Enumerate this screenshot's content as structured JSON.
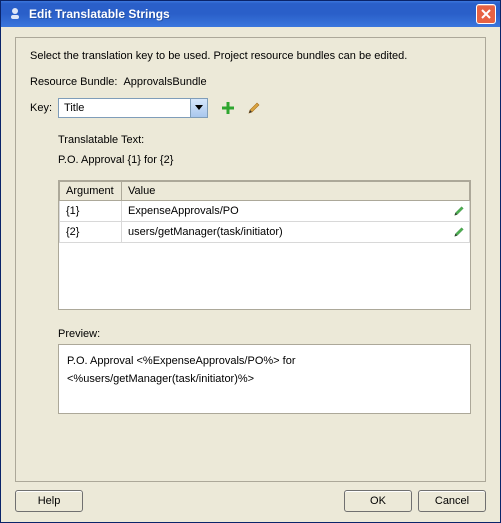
{
  "titlebar": {
    "title": "Edit Translatable Strings"
  },
  "instruction": "Select the translation key to be used. Project resource bundles can be edited.",
  "resource_bundle": {
    "label": "Resource Bundle:",
    "value": "ApprovalsBundle"
  },
  "key": {
    "label": "Key:",
    "selected": "Title"
  },
  "translatable": {
    "label": "Translatable Text:",
    "value": "P.O. Approval {1} for {2}"
  },
  "args_table": {
    "headers": {
      "argument": "Argument",
      "value": "Value"
    },
    "rows": [
      {
        "arg": "{1}",
        "value": "ExpenseApprovals/PO"
      },
      {
        "arg": "{2}",
        "value": "users/getManager(task/initiator)"
      }
    ]
  },
  "preview": {
    "label": "Preview:",
    "text": "P.O. Approval <%ExpenseApprovals/PO%> for <%users/getManager(task/initiator)%>"
  },
  "buttons": {
    "help": "Help",
    "ok": "OK",
    "cancel": "Cancel"
  }
}
